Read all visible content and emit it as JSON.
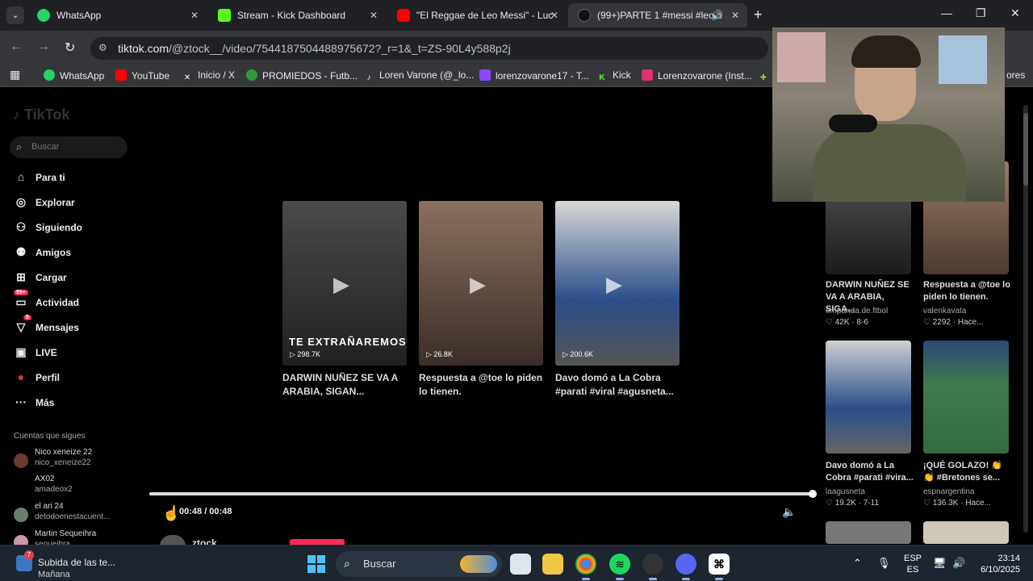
{
  "tabs": [
    {
      "title": "WhatsApp",
      "color": "#25d366"
    },
    {
      "title": "Stream - Kick Dashboard",
      "color": "#53fc18"
    },
    {
      "title": "\"El Reggae de Leo Messi\" - Luc",
      "color": "#ff0000"
    },
    {
      "title": "(99+)PARTE 1 #messi #leom",
      "color": "#111111"
    }
  ],
  "address": {
    "url_host": "tiktok.com",
    "url_path": "/@ztock__/video/7544187504488975672?_r=1&_t=ZS-90L4y588p2j"
  },
  "bookmarks": [
    {
      "label": "WhatsApp",
      "icon": "whatsapp-icon",
      "color": "#25d366"
    },
    {
      "label": "YouTube",
      "icon": "youtube-icon",
      "color": "#ff0000"
    },
    {
      "label": "Inicio / X",
      "icon": "x-icon",
      "color": "#ffffff"
    },
    {
      "label": "PROMIEDOS - Futb...",
      "icon": "promiedos-icon",
      "color": "#2e9b3f"
    },
    {
      "label": "Loren Varone (@_lo...",
      "icon": "tiktok-icon",
      "color": "#111111"
    },
    {
      "label": "lorenzovarone17 - T...",
      "icon": "twitch-icon",
      "color": "#9146ff"
    },
    {
      "label": "Kick",
      "icon": "kick-icon",
      "color": "#53fc18"
    },
    {
      "label": "Lorenzovarone (Inst...",
      "icon": "instagram-icon",
      "color": "#e1306c"
    }
  ],
  "bookmarks_more": "ores",
  "sidebar": {
    "search_placeholder": "Buscar",
    "nav": [
      {
        "label": "Para ti",
        "icon": "home-icon"
      },
      {
        "label": "Explorar",
        "icon": "compass-icon"
      },
      {
        "label": "Siguiendo",
        "icon": "following-icon"
      },
      {
        "label": "Amigos",
        "icon": "friends-icon"
      },
      {
        "label": "Cargar",
        "icon": "upload-icon"
      },
      {
        "label": "Actividad",
        "icon": "activity-icon",
        "badge": "99+"
      },
      {
        "label": "Mensajes",
        "icon": "messages-icon",
        "badge": "5"
      },
      {
        "label": "LIVE",
        "icon": "live-icon"
      },
      {
        "label": "Perfil",
        "icon": "profile-icon"
      },
      {
        "label": "Más",
        "icon": "more-icon"
      }
    ],
    "following_title": "Cuentas que sigues",
    "following": [
      {
        "name": "Nico xeneize 22",
        "user": "nico_xeneize22"
      },
      {
        "name": "AX02",
        "user": "amadeox2"
      },
      {
        "name": "el ari 24",
        "user": "detodoenestacuent..."
      },
      {
        "name": "Martin Sequeihra",
        "user": "sequeihra"
      }
    ]
  },
  "grid": [
    {
      "caption": "DARWIN NUÑEZ SE VA A ARABIA, SIGAN...",
      "views": "298.7K",
      "overlay": "TE EXTRAÑAREMOS",
      "color": "#3a3a3a"
    },
    {
      "caption": "Respuesta a @toe lo piden lo tienen.",
      "views": "26.8K",
      "overlay": "",
      "color": "#6b5a4c"
    },
    {
      "caption": "Davo domó a La Cobra #parati #viral #agusneta...",
      "views": "200.6K",
      "overlay": "",
      "color": "#c9c9c9"
    }
  ],
  "player": {
    "time": "00:48 / 00:48",
    "progress": 1.0,
    "author": "ztock"
  },
  "recommended": [
    {
      "title": "DARWIN NUÑEZ SE VA A ARABIA, SIGA...",
      "user": "empanda.de.ftbol",
      "stats": "♡ 42K · 8-6",
      "color": "#3c3c3c"
    },
    {
      "title": "Respuesta a @toe lo piden lo tienen.",
      "user": "valenkavata",
      "stats": "♡ 2292 · Hace...",
      "color": "#7a6050"
    },
    {
      "title": "Davo domó a La Cobra #parati #vira...",
      "user": "laagusneta",
      "stats": "♡ 19.2K · 7-11",
      "color": "#bcbcbc"
    },
    {
      "title": "¡QUÉ GOLAZO! 👏 👏 #Bretones se...",
      "user": "espnargentina",
      "stats": "♡ 136.3K · Hace...",
      "color": "#3f7a4a"
    }
  ],
  "taskbar": {
    "notif_title": "Subida de las te...",
    "notif_sub": "Mañana",
    "notif_badge": "7",
    "search": "Buscar",
    "lang1": "ESP",
    "lang2": "ES",
    "time": "23:14",
    "date": "6/10/2025"
  }
}
